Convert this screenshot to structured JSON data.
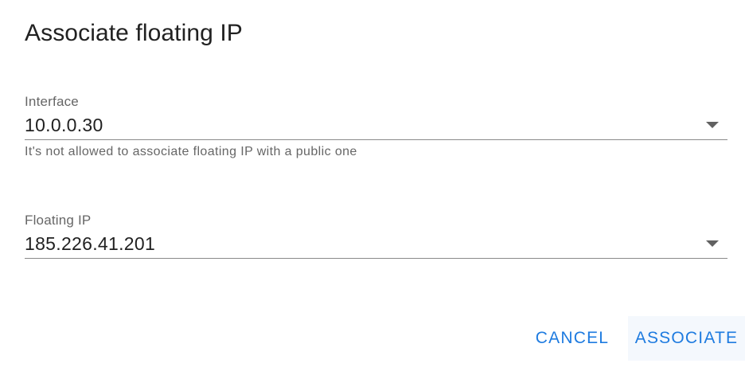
{
  "dialog": {
    "title": "Associate floating IP"
  },
  "interface_field": {
    "label": "Interface",
    "value": "10.0.0.30",
    "hint": "It's not allowed to associate floating IP with a public one"
  },
  "floating_ip_field": {
    "label": "Floating IP",
    "value": "185.226.41.201"
  },
  "actions": {
    "cancel_label": "CANCEL",
    "associate_label": "ASSOCIATE"
  },
  "colors": {
    "accent": "#1e7be0",
    "text_primary": "#212121",
    "text_secondary": "#666666",
    "underline": "#8a8a8a"
  },
  "icons": {
    "dropdown": "arrow-drop-down-icon"
  }
}
